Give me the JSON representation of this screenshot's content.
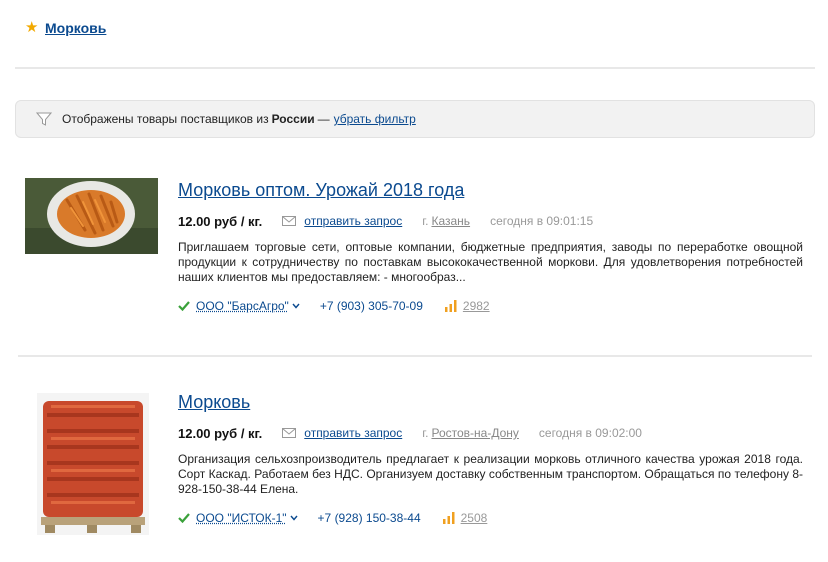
{
  "breadcrumb": {
    "label": "Морковь"
  },
  "filter": {
    "text": "Отображены товары поставщиков из",
    "country": "России",
    "dash": "—",
    "remove_link": "убрать фильтр"
  },
  "products": [
    {
      "title": "Морковь оптом. Урожай 2018 года",
      "price": "12.00 руб",
      "unit": "/ кг.",
      "request_link": "отправить запрос",
      "city_prefix": "г.",
      "city": "Казань",
      "time": "сегодня в 09:01:15",
      "description": "Приглашаем торговые сети, оптовые компании, бюджетные предприятия, заводы по переработке овощной продукции к сотрудничеству по поставкам высококачественной моркови. Для удовлетворения потребностей наших клиентов мы предоставляем: - многообраз...",
      "company": "ООО \"БарсАгро\"",
      "phone": "+7 (903) 305-70-09",
      "views": "2982"
    },
    {
      "title": "Морковь",
      "price": "12.00 руб",
      "unit": "/ кг.",
      "request_link": "отправить запрос",
      "city_prefix": "г.",
      "city": "Ростов-на-Дону",
      "time": "сегодня в 09:02:00",
      "description": "Организация сельхозпроизводитель предлагает к реализации морковь отличного качества урожая 2018 года. Сорт Каскад. Работаем без НДС. Организуем доставку собственным транспортом. Обращаться по телефону 8-928-150-38-44 Елена.",
      "company": "ООО \"ИСТОК-1\"",
      "phone": "+7 (928) 150-38-44",
      "views": "2508"
    }
  ],
  "colors": {
    "link": "#0b4a8f",
    "star": "#f2a900",
    "check": "#3aa13a",
    "bars": "#f0a020"
  }
}
